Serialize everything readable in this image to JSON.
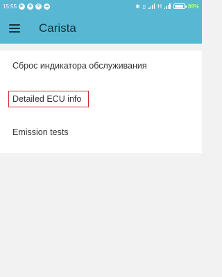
{
  "status_bar": {
    "time": "15:55",
    "network_type": "H",
    "battery_percent": "89%",
    "battery_level": 0.89,
    "left_icons": [
      "play-icon",
      "whatsapp-icon",
      "settings-icon",
      "cloud-icon"
    ],
    "right_icons": [
      "bluetooth-icon",
      "vibrate-icon",
      "signal-icon",
      "signal-icon",
      "battery-icon"
    ]
  },
  "app_bar": {
    "title": "Carista",
    "menu_icon": "hamburger-icon",
    "background_color": "#58b7d3"
  },
  "menu": {
    "items": [
      {
        "label": "Сброс индикатора обслуживания"
      },
      {
        "label": "Detailed ECU info",
        "highlighted": true,
        "highlight_color": "#d6262b"
      },
      {
        "label": "Emission tests"
      }
    ]
  }
}
